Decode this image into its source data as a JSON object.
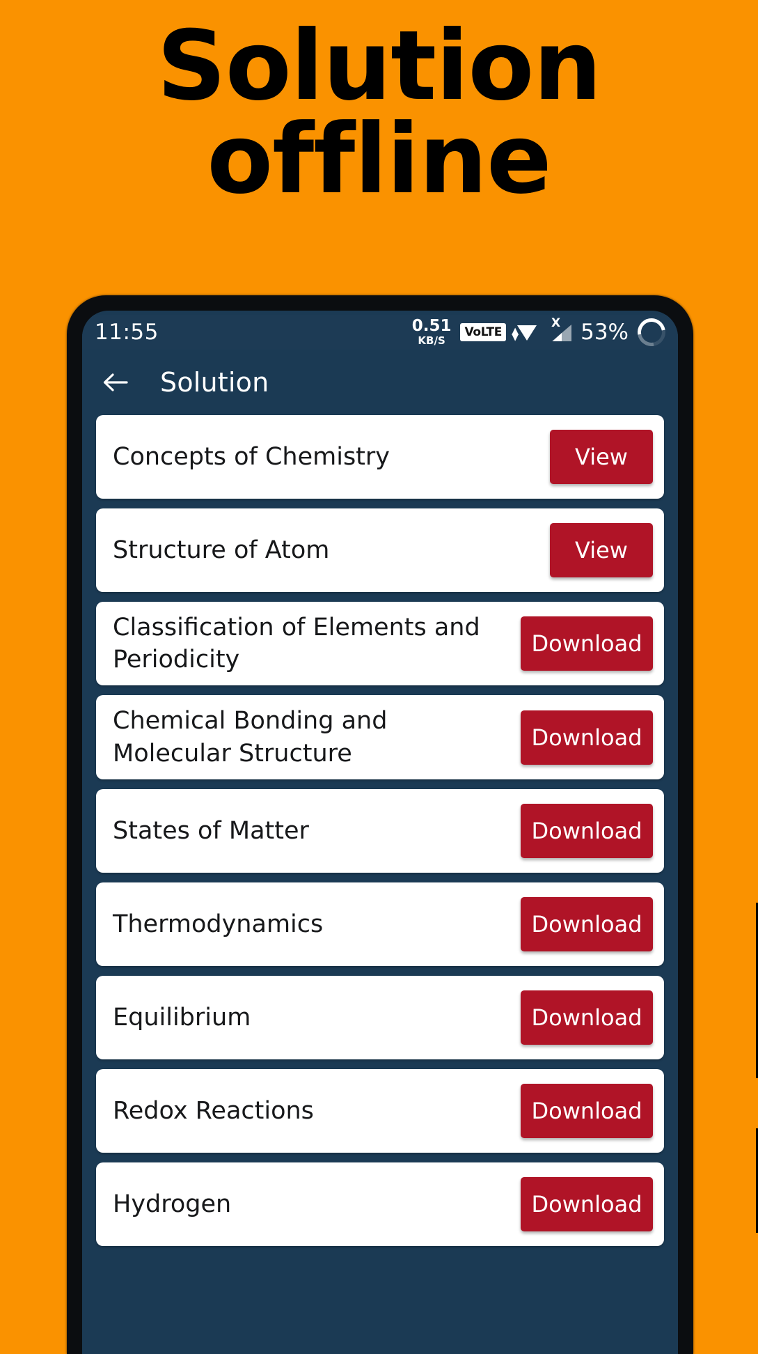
{
  "promo": {
    "headline": "Solution\noffline",
    "background_color": "#FA9200"
  },
  "phone": {
    "frame_color": "#0b0d10",
    "screen_background": "#1B3A54"
  },
  "status_bar": {
    "clock": "11:55",
    "network_rate": "0.51",
    "network_unit": "KB/S",
    "volte_badge": "VoLTE",
    "wifi_icon": "wifi-icon",
    "signal_icon": "signal-no-service-icon",
    "signal_x": "X",
    "battery_percent": "53%",
    "battery_icon": "battery-ring-icon"
  },
  "appbar": {
    "back_icon": "back-arrow-icon",
    "title": "Solution",
    "background_color": "#1B3A54"
  },
  "theme": {
    "accent_red": "#B01427",
    "card_background": "#FFFFFF"
  },
  "list": {
    "items": [
      {
        "title": "Concepts of Chemistry",
        "action": "View",
        "action_type": "view"
      },
      {
        "title": "Structure of Atom",
        "action": "View",
        "action_type": "view"
      },
      {
        "title": "Classification of Elements and Periodicity",
        "action": "Download",
        "action_type": "download"
      },
      {
        "title": "Chemical Bonding and Molecular Structure",
        "action": "Download",
        "action_type": "download"
      },
      {
        "title": "States of Matter",
        "action": "Download",
        "action_type": "download"
      },
      {
        "title": "Thermodynamics",
        "action": "Download",
        "action_type": "download"
      },
      {
        "title": "Equilibrium",
        "action": "Download",
        "action_type": "download"
      },
      {
        "title": "Redox Reactions",
        "action": "Download",
        "action_type": "download"
      },
      {
        "title": "Hydrogen",
        "action": "Download",
        "action_type": "download"
      }
    ]
  }
}
